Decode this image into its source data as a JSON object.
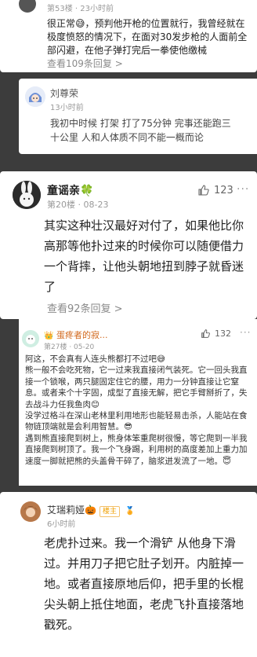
{
  "comments": [
    {
      "meta": "第53楼 · 23小时前",
      "text": "很正常😅，预判他开枪的位置就行，我曾经就在极度愤怒的情况下，在面对30发步枪的人面前全部闪避，在他子弹打完后一拳使他缴械",
      "more": "查看109条回复 >"
    },
    {
      "username": "刘尊荣",
      "meta": "13小时前",
      "text": "我初中时候 打架 打了75分钟 完事还能跑三十公里 人和人体质不同不能一概而论"
    },
    {
      "username": "童谣亲🍀",
      "meta": "第20楼 · 08-23",
      "likes": "123",
      "text": "其实这种壮汉最好对付了，如果他比你高那等他扑过来的时候你可以随便借力一个背摔，让他头朝地扭到脖子就昏迷了",
      "more": "查看92条回复 >"
    },
    {
      "username": "蛋疼者的寂...",
      "meta": "第27楼 · 05-20",
      "likes": "132",
      "text": "阿这，不会真有人连头熊都打不过吧😅\n熊一般不会吃死物，它一过来我直接闭气装死。它一回头我直接一个锁喉，两只腿固定住它的腰，用力一分钟直接让它窒息。或者来个十字固，成型了直接无解，把它手臂掰折了，失去战斗力任我鱼肉😊\n没学过格斗在深山老林里利用地形也能轻易击杀，人能站在食物链顶端就是会利用智慧。😎\n遇到熊直接爬到树上，熊身体笨重爬树很慢，等它爬到一半我直接爬到树顶了。我一个飞身踢，利用树的高度差加上重力加速度一脚就把熊的头盖骨干碎了，脑浆迸发流了一地。😇"
    },
    {
      "username": "艾瑞莉娅🎃",
      "tag": "楼主",
      "meta": "6小时前",
      "text": "老虎扑过来。我一个滑铲 从他身下滑过。并用刀子把它肚子划开。内脏掉一地。或者直接原地后仰，把手里的长棍尖头朝上抵住地面，老虎飞扑直接落地戳死。"
    }
  ],
  "menu_icon_label": "···",
  "colors": {
    "accent": "#f0a000",
    "meta": "#999999",
    "background": "#3c3c3c"
  }
}
